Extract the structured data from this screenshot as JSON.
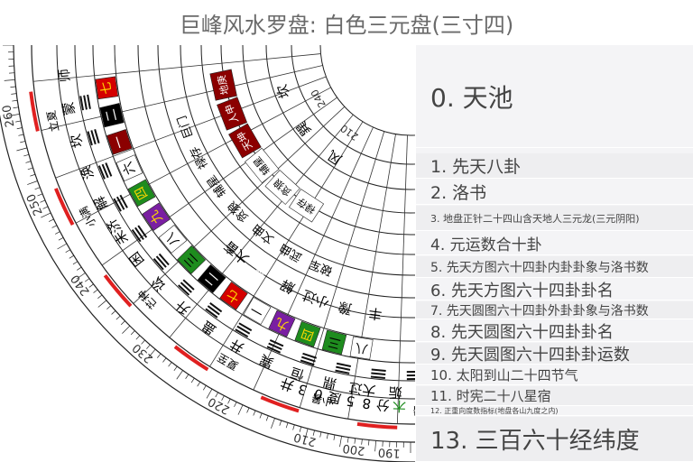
{
  "header": {
    "title": "巨峰风水罗盘: 白色三元盘(三寸四)"
  },
  "menu": {
    "items": [
      {
        "label": "0. 天池"
      },
      {
        "label": "1. 先天八卦"
      },
      {
        "label": "2. 洛书"
      },
      {
        "label": "3. 地盘正针二十四山含天地人三元龙(三元阴阳)"
      },
      {
        "label": "4. 元运数合十卦"
      },
      {
        "label": "5. 先天方图六十四卦内卦卦象与洛书数"
      },
      {
        "label": "6. 先天方图六十四卦卦名"
      },
      {
        "label": "7. 先天圆图六十四卦外卦卦象与洛书数"
      },
      {
        "label": "8. 先天圆图六十四卦卦名"
      },
      {
        "label": "9. 先天圆图六十四卦卦运数"
      },
      {
        "label": "10. 太阳到山二十四节气"
      },
      {
        "label": "11. 时宪二十八星宿"
      },
      {
        "label": "12. 正重向度数指标(地盘各山九度之内)"
      },
      {
        "label": "13. 三百六十经纬度"
      }
    ]
  },
  "compass": {
    "degree_labels": [
      "260",
      "250",
      "240",
      "230",
      "220",
      "210",
      "200",
      "190"
    ],
    "inner_degree_labels": [
      "240",
      "210"
    ],
    "trigram_cells": [
      "坎",
      "巽",
      "风"
    ],
    "mountains_outer": [
      "天",
      "人丁"
    ],
    "stars": [
      "巨门",
      "禄存",
      "辅星",
      "贪狼",
      "文曲",
      "武曲",
      "破军"
    ],
    "mountain_ring": [
      "地庚",
      "人申",
      "天坤",
      "辅星",
      "贪狼",
      "禄存"
    ],
    "hexagram_names_a": [
      "师",
      "蒙",
      "坎",
      "涣",
      "解",
      "未济",
      "困",
      "讼",
      "升",
      "蛊",
      "井",
      "巽",
      "恒",
      "鼎",
      "大过",
      "姤"
    ],
    "hexagram_names_b": [
      "大畜",
      "震",
      "解",
      "小过",
      "豫",
      "丰"
    ],
    "luoshu": [
      "七",
      "二",
      "一",
      "六",
      "四",
      "九",
      "八",
      "三",
      "二",
      "七",
      "一",
      "九",
      "四",
      "三",
      "八"
    ],
    "solar_terms": [
      "立夏",
      "小满",
      "芒种",
      "夏至",
      "小暑",
      "大暑"
    ],
    "mansions": [
      "井",
      "3",
      "0",
      "度",
      "5",
      "8",
      "分",
      "木"
    ],
    "colors": {
      "red": "#d40000",
      "dark_red": "#8b0000",
      "black": "#000000",
      "green": "#1e8c1e",
      "purple": "#7a1fa2",
      "yellow": "#ffd800",
      "degree_mark": "#e02020"
    }
  }
}
